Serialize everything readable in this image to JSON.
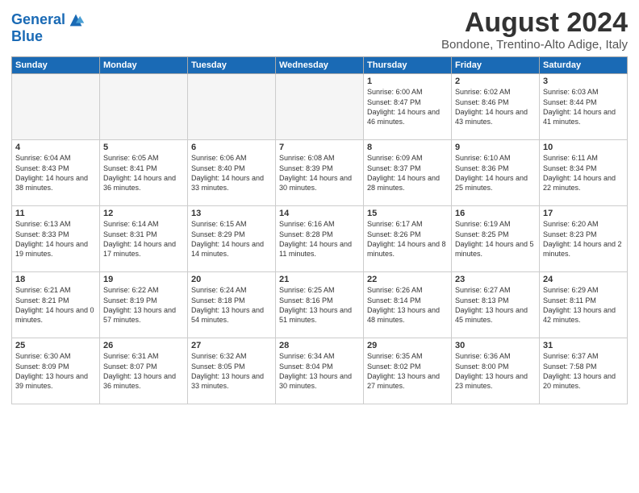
{
  "logo": {
    "line1": "General",
    "line2": "Blue"
  },
  "title": "August 2024",
  "location": "Bondone, Trentino-Alto Adige, Italy",
  "headers": [
    "Sunday",
    "Monday",
    "Tuesday",
    "Wednesday",
    "Thursday",
    "Friday",
    "Saturday"
  ],
  "weeks": [
    [
      {
        "day": "",
        "info": ""
      },
      {
        "day": "",
        "info": ""
      },
      {
        "day": "",
        "info": ""
      },
      {
        "day": "",
        "info": ""
      },
      {
        "day": "1",
        "info": "Sunrise: 6:00 AM\nSunset: 8:47 PM\nDaylight: 14 hours and 46 minutes."
      },
      {
        "day": "2",
        "info": "Sunrise: 6:02 AM\nSunset: 8:46 PM\nDaylight: 14 hours and 43 minutes."
      },
      {
        "day": "3",
        "info": "Sunrise: 6:03 AM\nSunset: 8:44 PM\nDaylight: 14 hours and 41 minutes."
      }
    ],
    [
      {
        "day": "4",
        "info": "Sunrise: 6:04 AM\nSunset: 8:43 PM\nDaylight: 14 hours and 38 minutes."
      },
      {
        "day": "5",
        "info": "Sunrise: 6:05 AM\nSunset: 8:41 PM\nDaylight: 14 hours and 36 minutes."
      },
      {
        "day": "6",
        "info": "Sunrise: 6:06 AM\nSunset: 8:40 PM\nDaylight: 14 hours and 33 minutes."
      },
      {
        "day": "7",
        "info": "Sunrise: 6:08 AM\nSunset: 8:39 PM\nDaylight: 14 hours and 30 minutes."
      },
      {
        "day": "8",
        "info": "Sunrise: 6:09 AM\nSunset: 8:37 PM\nDaylight: 14 hours and 28 minutes."
      },
      {
        "day": "9",
        "info": "Sunrise: 6:10 AM\nSunset: 8:36 PM\nDaylight: 14 hours and 25 minutes."
      },
      {
        "day": "10",
        "info": "Sunrise: 6:11 AM\nSunset: 8:34 PM\nDaylight: 14 hours and 22 minutes."
      }
    ],
    [
      {
        "day": "11",
        "info": "Sunrise: 6:13 AM\nSunset: 8:33 PM\nDaylight: 14 hours and 19 minutes."
      },
      {
        "day": "12",
        "info": "Sunrise: 6:14 AM\nSunset: 8:31 PM\nDaylight: 14 hours and 17 minutes."
      },
      {
        "day": "13",
        "info": "Sunrise: 6:15 AM\nSunset: 8:29 PM\nDaylight: 14 hours and 14 minutes."
      },
      {
        "day": "14",
        "info": "Sunrise: 6:16 AM\nSunset: 8:28 PM\nDaylight: 14 hours and 11 minutes."
      },
      {
        "day": "15",
        "info": "Sunrise: 6:17 AM\nSunset: 8:26 PM\nDaylight: 14 hours and 8 minutes."
      },
      {
        "day": "16",
        "info": "Sunrise: 6:19 AM\nSunset: 8:25 PM\nDaylight: 14 hours and 5 minutes."
      },
      {
        "day": "17",
        "info": "Sunrise: 6:20 AM\nSunset: 8:23 PM\nDaylight: 14 hours and 2 minutes."
      }
    ],
    [
      {
        "day": "18",
        "info": "Sunrise: 6:21 AM\nSunset: 8:21 PM\nDaylight: 14 hours and 0 minutes."
      },
      {
        "day": "19",
        "info": "Sunrise: 6:22 AM\nSunset: 8:19 PM\nDaylight: 13 hours and 57 minutes."
      },
      {
        "day": "20",
        "info": "Sunrise: 6:24 AM\nSunset: 8:18 PM\nDaylight: 13 hours and 54 minutes."
      },
      {
        "day": "21",
        "info": "Sunrise: 6:25 AM\nSunset: 8:16 PM\nDaylight: 13 hours and 51 minutes."
      },
      {
        "day": "22",
        "info": "Sunrise: 6:26 AM\nSunset: 8:14 PM\nDaylight: 13 hours and 48 minutes."
      },
      {
        "day": "23",
        "info": "Sunrise: 6:27 AM\nSunset: 8:13 PM\nDaylight: 13 hours and 45 minutes."
      },
      {
        "day": "24",
        "info": "Sunrise: 6:29 AM\nSunset: 8:11 PM\nDaylight: 13 hours and 42 minutes."
      }
    ],
    [
      {
        "day": "25",
        "info": "Sunrise: 6:30 AM\nSunset: 8:09 PM\nDaylight: 13 hours and 39 minutes."
      },
      {
        "day": "26",
        "info": "Sunrise: 6:31 AM\nSunset: 8:07 PM\nDaylight: 13 hours and 36 minutes."
      },
      {
        "day": "27",
        "info": "Sunrise: 6:32 AM\nSunset: 8:05 PM\nDaylight: 13 hours and 33 minutes."
      },
      {
        "day": "28",
        "info": "Sunrise: 6:34 AM\nSunset: 8:04 PM\nDaylight: 13 hours and 30 minutes."
      },
      {
        "day": "29",
        "info": "Sunrise: 6:35 AM\nSunset: 8:02 PM\nDaylight: 13 hours and 27 minutes."
      },
      {
        "day": "30",
        "info": "Sunrise: 6:36 AM\nSunset: 8:00 PM\nDaylight: 13 hours and 23 minutes."
      },
      {
        "day": "31",
        "info": "Sunrise: 6:37 AM\nSunset: 7:58 PM\nDaylight: 13 hours and 20 minutes."
      }
    ]
  ]
}
